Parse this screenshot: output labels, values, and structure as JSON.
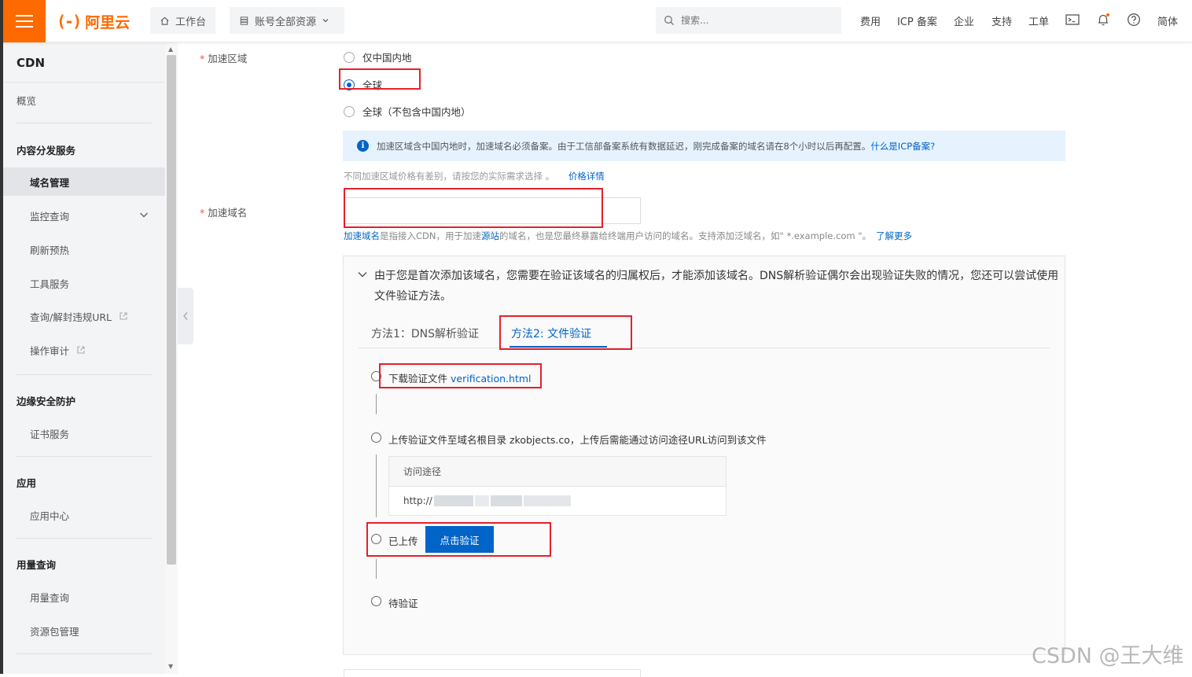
{
  "colors": {
    "accent": "#ff6a00",
    "primary": "#0064c8",
    "highlight_box": "#e5202a"
  },
  "topbar": {
    "logo_text": "阿里云",
    "workbench": "工作台",
    "resources": "账号全部资源",
    "search_placeholder": "搜索...",
    "links": [
      "费用",
      "ICP 备案",
      "企业",
      "支持",
      "工单"
    ],
    "lang": "简体",
    "icons": [
      "terminal-icon",
      "bell-icon",
      "help-icon"
    ]
  },
  "sidebar": {
    "title": "CDN",
    "overview": "概览",
    "groups": [
      {
        "title": "内容分发服务",
        "items": [
          "域名管理",
          "监控查询",
          "刷新预热",
          "工具服务",
          "查询/解封违规URL",
          "操作审计"
        ]
      },
      {
        "title": "边缘安全防护",
        "items": [
          "证书服务"
        ]
      },
      {
        "title": "应用",
        "items": [
          "应用中心"
        ]
      },
      {
        "title": "用量查询",
        "items": [
          "用量查询",
          "资源包管理"
        ]
      }
    ]
  },
  "form": {
    "region_label": "加速区域",
    "region_options": [
      "仅中国内地",
      "全球",
      "全球（不包含中国内地）"
    ],
    "region_selected": "全球",
    "info_text": "加速区域含中国内地时，加速域名必须备案。由于工信部备案系统有数据延迟，刚完成备案的域名请在8个小时以后再配置。",
    "info_link": "什么是ICP备案?",
    "price_hint": "不同加速区域价格有差别，请按您的实际需求选择 。",
    "price_link": "价格详情",
    "domain_label": "加速域名",
    "domain_value": "",
    "domain_hint_link1": "加速域名",
    "domain_hint_mid1": "是指接入CDN，用于加速",
    "domain_hint_link2": "源站",
    "domain_hint_mid2": "的域名，也是您最终暴露给终端用户访问的域名。支持添加泛域名，如\" *.example.com \"。",
    "domain_hint_link3": "了解更多"
  },
  "verify": {
    "notice": "由于您是首次添加该域名，您需要在验证该域名的归属权后，才能添加该域名。DNS解析验证偶尔会出现验证失败的情况，您还可以尝试使用文件验证方法。",
    "tabs": [
      "方法1：DNS解析验证",
      "方法2: 文件验证"
    ],
    "active_tab": "方法2: 文件验证",
    "step1_text": "下载验证文件",
    "step1_link": "verification.html",
    "step2_text": "上传验证文件至域名根目录 zkobjects.co，上传后需能通过访问途径URL访问到该文件",
    "path_header": "访问途径",
    "path_prefix": "http://",
    "step3_text": "已上传",
    "verify_button": "点击验证",
    "step4_text": "待验证"
  },
  "watermark": "CSDN @王大维"
}
